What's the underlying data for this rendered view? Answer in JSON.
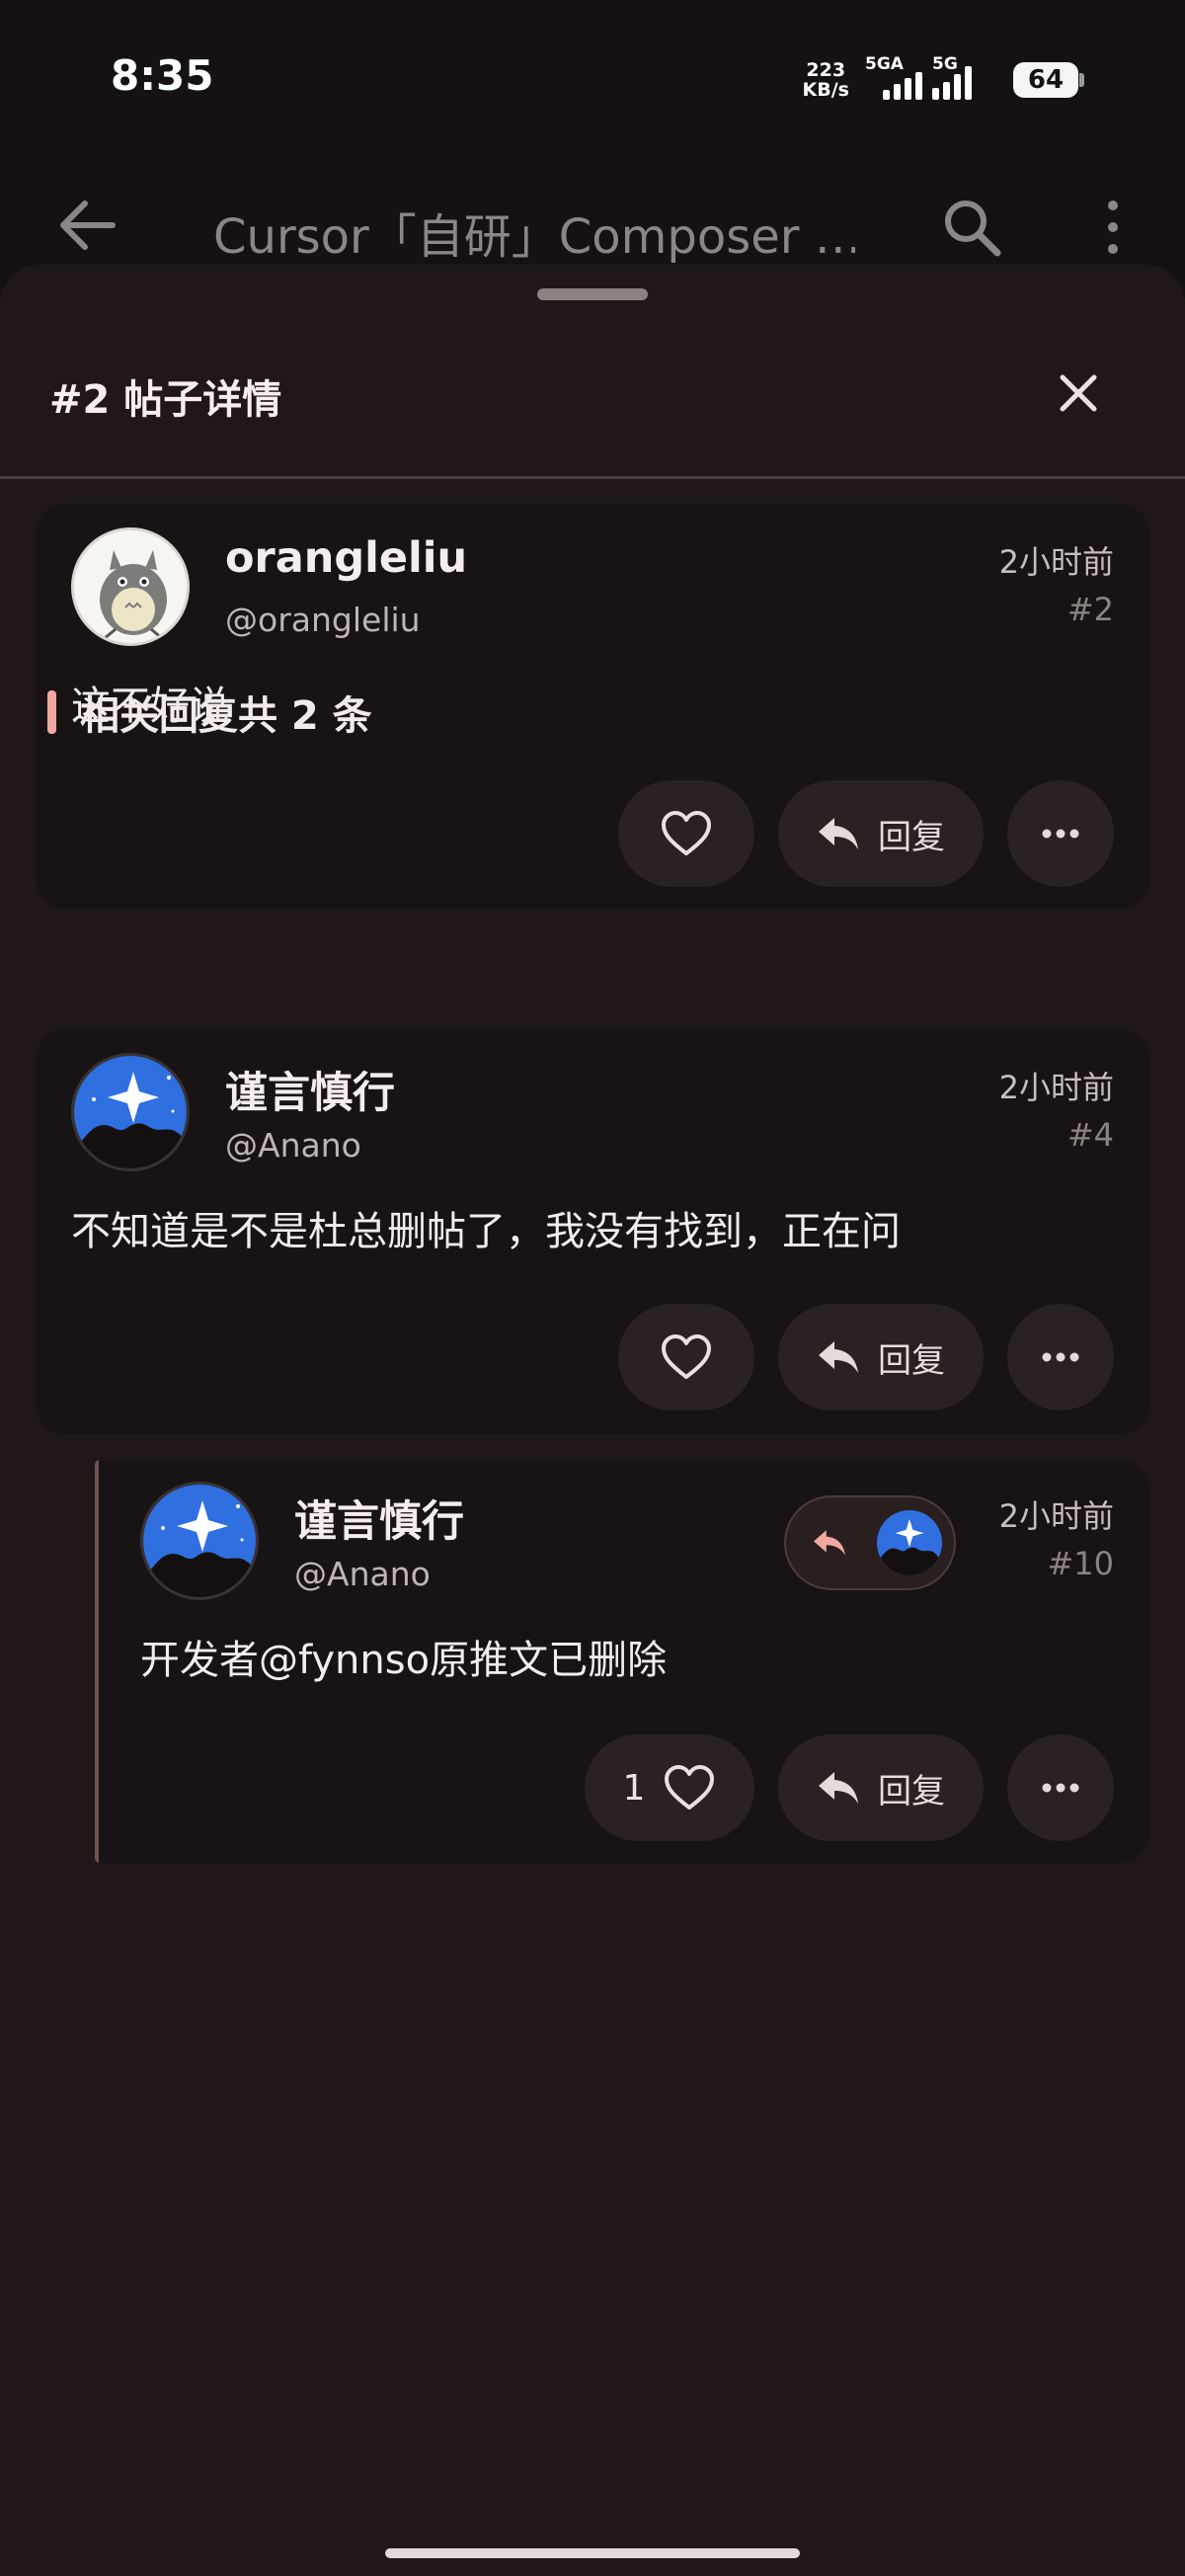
{
  "status_bar": {
    "time": "8:35",
    "net_speed_value": "223",
    "net_speed_unit": "KB/s",
    "signal1_label": "5GA",
    "signal2_label": "5G",
    "battery": "64"
  },
  "app_bar": {
    "title": "Cursor「自研」Composer …"
  },
  "sheet": {
    "title": "#2 帖子详情"
  },
  "main_post": {
    "author": "orangleliu",
    "handle": "@orangleliu",
    "time": "2小时前",
    "floor": "#2",
    "body": "这不好说",
    "reply_label": "回复"
  },
  "section": {
    "title": "相关回复共 2 条"
  },
  "replies": [
    {
      "author": "谨言慎行",
      "handle": "@Anano",
      "time": "2小时前",
      "floor": "#4",
      "body": "不知道是不是杜总删帖了，我没有找到，正在问",
      "reply_label": "回复"
    },
    {
      "author": "谨言慎行",
      "handle": "@Anano",
      "time": "2小时前",
      "floor": "#10",
      "body": "开发者@fynnso原推文已删除",
      "like_count": "1",
      "reply_label": "回复"
    }
  ],
  "colors": {
    "accent": "#f0a8a0",
    "card_bg": "#181314",
    "sheet_bg": "#201818"
  }
}
